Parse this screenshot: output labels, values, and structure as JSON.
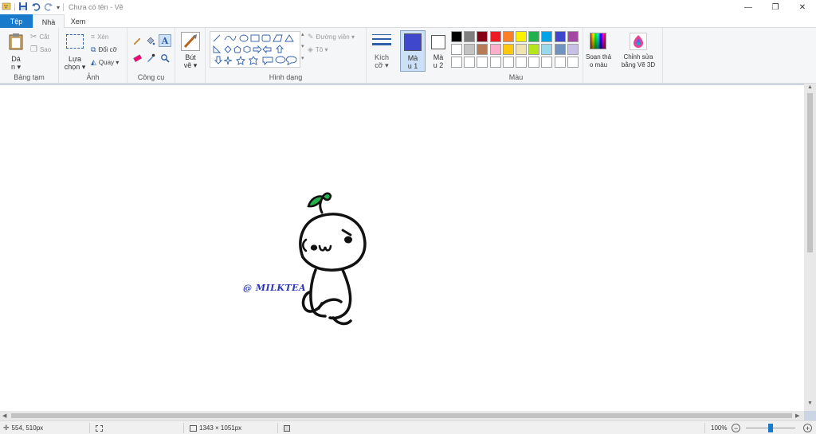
{
  "titlebar": {
    "title": "Chưa có tên - Vẽ",
    "controls": [
      "—",
      "❐",
      "✕"
    ]
  },
  "tabs": {
    "file": "Tệp",
    "home": "Nhà",
    "view": "Xem"
  },
  "ribbon": {
    "clipboard": {
      "paste": "Dá",
      "paste2": "n ▾",
      "cut": "Cắt",
      "copy": "Sao",
      "label": "Bảng tạm"
    },
    "image": {
      "select": "Lựa",
      "select2": "chọn ▾",
      "crop": "Xén",
      "resize": "Đổi cỡ",
      "rotate": "Quay ▾",
      "label": "Ảnh"
    },
    "tools": {
      "label": "Công cụ"
    },
    "brushes": {
      "label": "Bút",
      "label2": "vẽ ▾"
    },
    "shapes": {
      "outline": "Đường viền ▾",
      "fill": "Tô ▾",
      "label": "Hình dạng"
    },
    "size": {
      "label": "Kích",
      "label2": "cỡ ▾"
    },
    "color1": {
      "label": "Mà",
      "label2": "u 1",
      "value": "#3f48cc"
    },
    "color2": {
      "label": "Mà",
      "label2": "u 2",
      "value": "#ffffff"
    },
    "palette": {
      "label": "Màu",
      "row1": [
        "#000000",
        "#7f7f7f",
        "#880015",
        "#ed1c24",
        "#ff7f27",
        "#fff200",
        "#22b14c",
        "#00a2e8",
        "#3f48cc",
        "#a349a4"
      ],
      "row2": [
        "#ffffff",
        "#c3c3c3",
        "#b97a57",
        "#ffaec9",
        "#ffc90e",
        "#efe4b0",
        "#b5e61d",
        "#99d9ea",
        "#7092be",
        "#c8bfe7"
      ]
    },
    "edit_colors": {
      "label": "Soạn thả",
      "label2": "o màu"
    },
    "paint3d": {
      "label": "Chỉnh sửa",
      "label2": "bằng Vẽ 3D"
    }
  },
  "canvas": {
    "watermark": "@ MILKTEA"
  },
  "statusbar": {
    "cursor": "554, 510px",
    "canvas_size": "1343 × 1051px",
    "zoom": "100%",
    "zoom_minus": "−",
    "zoom_plus": "+",
    "zoom_level_percent": 100
  }
}
